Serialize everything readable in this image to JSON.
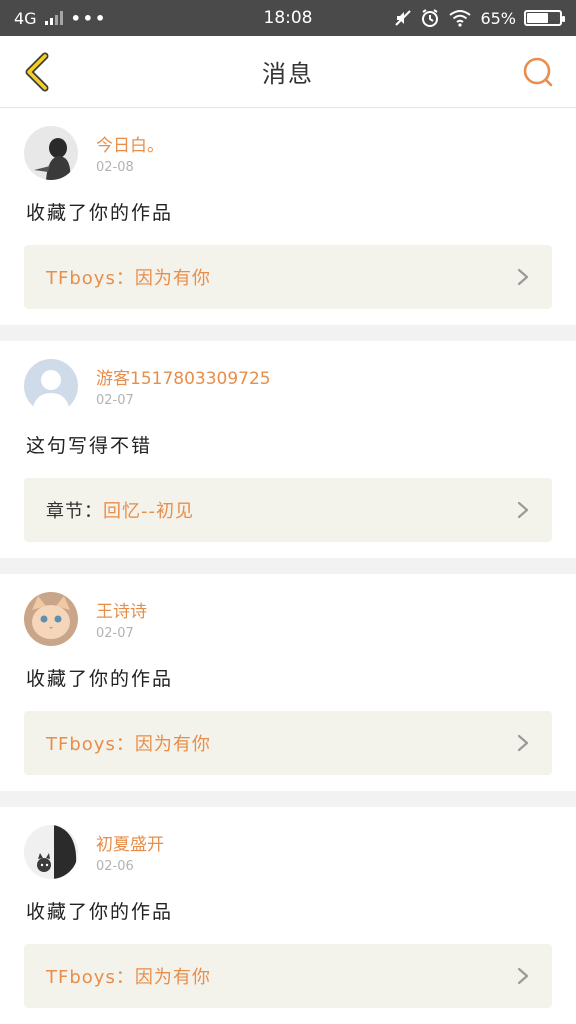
{
  "status_bar": {
    "network": "4G",
    "dots": "•••",
    "time": "18:08",
    "battery_percent": "65%",
    "battery_level": 0.65
  },
  "header": {
    "title": "消息"
  },
  "messages": [
    {
      "username": "今日白。",
      "date": "02-08",
      "text": "收藏了你的作品",
      "ref_prefix": "TFboys：",
      "ref_title": "因为有你"
    },
    {
      "username": "游客1517803309725",
      "date": "02-07",
      "text": "这句写得不错",
      "ref_prefix": "章节：",
      "ref_title": "回忆--初见"
    },
    {
      "username": "王诗诗",
      "date": "02-07",
      "text": "收藏了你的作品",
      "ref_prefix": "TFboys：",
      "ref_title": "因为有你"
    },
    {
      "username": "初夏盛开",
      "date": "02-06",
      "text": "收藏了你的作品",
      "ref_prefix": "TFboys：",
      "ref_title": "因为有你"
    }
  ],
  "colors": {
    "accent": "#e88d4a",
    "status_bar": "#4a4a4a",
    "ref_box": "#f4f3eb",
    "back_icon": "#f5d020"
  },
  "icons": {
    "back": "chevron-left-icon",
    "search": "search-icon",
    "ref_arrow": "chevron-right-icon"
  }
}
